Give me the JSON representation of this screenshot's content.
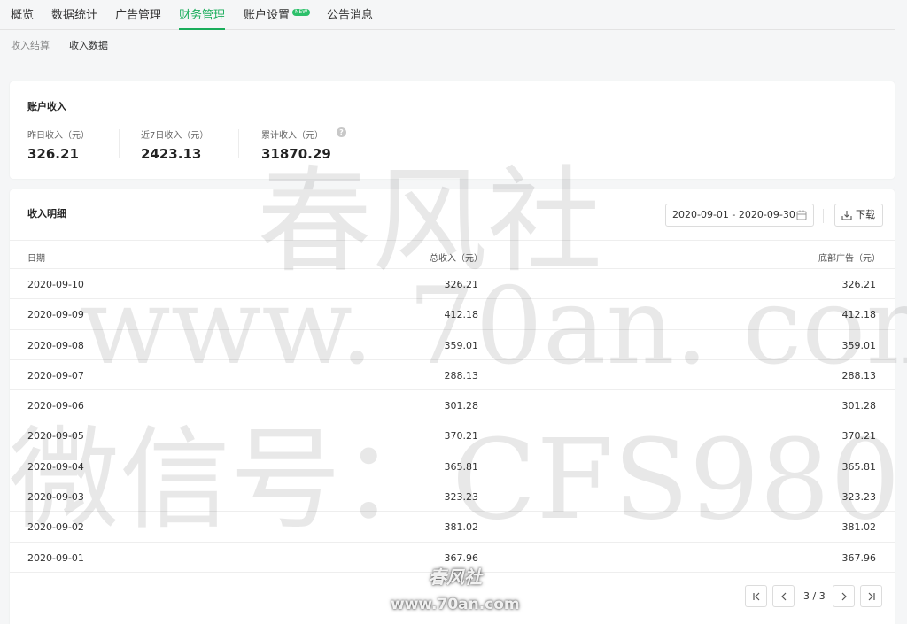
{
  "nav": {
    "tabs": [
      {
        "label": "概览"
      },
      {
        "label": "数据统计"
      },
      {
        "label": "广告管理"
      },
      {
        "label": "财务管理"
      },
      {
        "label": "账户设置",
        "badge": "NEW"
      },
      {
        "label": "公告消息"
      }
    ],
    "active_tab": "财务管理",
    "subtabs": [
      {
        "label": "收入结算"
      },
      {
        "label": "收入数据"
      }
    ],
    "active_subtab": "收入数据"
  },
  "account": {
    "title": "账户收入",
    "stats": [
      {
        "label": "昨日收入（元）",
        "value": "326.21"
      },
      {
        "label": "近7日收入（元）",
        "value": "2423.13"
      },
      {
        "label": "累计收入（元）",
        "value": "31870.29"
      }
    ],
    "help_icon": "question-circle-icon",
    "help_glyph": "?"
  },
  "detail": {
    "title": "收入明细",
    "date_range": "2020-09-01 - 2020-09-30",
    "download_label": "下载",
    "columns": [
      "日期",
      "总收入（元）",
      "底部广告（元）"
    ],
    "rows": [
      {
        "date": "2020-09-10",
        "total": "326.21",
        "ad": "326.21"
      },
      {
        "date": "2020-09-09",
        "total": "412.18",
        "ad": "412.18"
      },
      {
        "date": "2020-09-08",
        "total": "359.01",
        "ad": "359.01"
      },
      {
        "date": "2020-09-07",
        "total": "288.13",
        "ad": "288.13"
      },
      {
        "date": "2020-09-06",
        "total": "301.28",
        "ad": "301.28"
      },
      {
        "date": "2020-09-05",
        "total": "370.21",
        "ad": "370.21"
      },
      {
        "date": "2020-09-04",
        "total": "365.81",
        "ad": "365.81"
      },
      {
        "date": "2020-09-03",
        "total": "323.23",
        "ad": "323.23"
      },
      {
        "date": "2020-09-02",
        "total": "381.02",
        "ad": "381.02"
      },
      {
        "date": "2020-09-01",
        "total": "367.96",
        "ad": "367.96"
      }
    ],
    "pagination": {
      "info": "3 / 3"
    }
  },
  "watermark": {
    "line1": "春风社",
    "line2": "www. 70an. com",
    "line3": "微信号：CFS980",
    "logo_text": "春风社",
    "logo_url": "www.70an.com"
  },
  "colors": {
    "accent": "#1aad5b"
  }
}
